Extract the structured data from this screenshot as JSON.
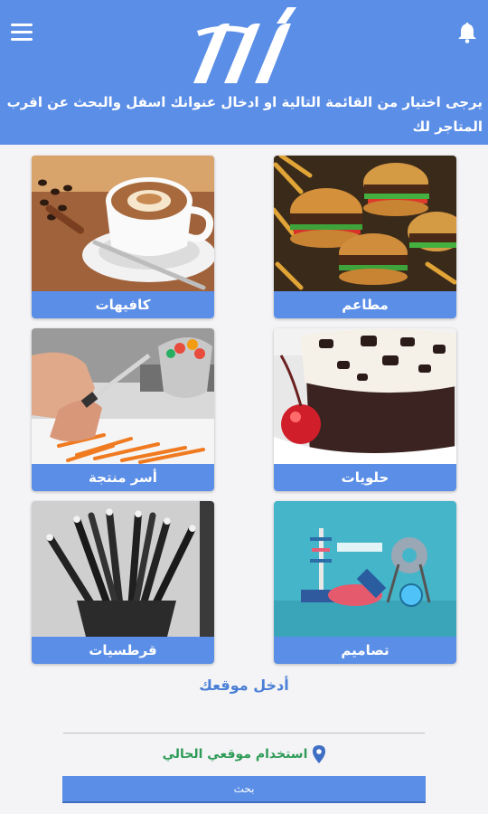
{
  "header": {
    "instruction_text": "يرجى اختيار من القائمة التالية او ادخال عنوانك اسفل والبحث عن اقرب المتاجر لك",
    "accent_color": "#5b8ee6"
  },
  "categories": [
    {
      "label": "مطاعم",
      "image": "burgers"
    },
    {
      "label": "كافيهات",
      "image": "coffee-cup"
    },
    {
      "label": "حلويات",
      "image": "cake-slice"
    },
    {
      "label": "أسر منتجة",
      "image": "cooking-hands"
    },
    {
      "label": "تصاميم",
      "image": "design-objects"
    },
    {
      "label": "قرطسيات",
      "image": "pencil-cup"
    }
  ],
  "location": {
    "title": "أدخل موقعك",
    "use_current_label": "استخدام موقعي الحالي",
    "search_button": "بحث"
  }
}
